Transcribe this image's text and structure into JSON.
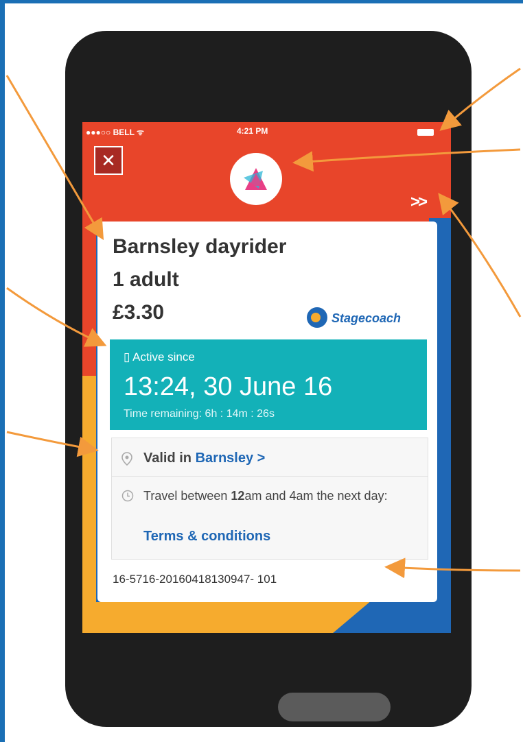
{
  "status_bar": {
    "carrier": "●●●○○ BELL ᯤ",
    "time": "4:21 PM"
  },
  "header": {
    "close_label": "✕",
    "next_label": ">>"
  },
  "ticket": {
    "name": "Barnsley dayrider",
    "quantity": "1 adult",
    "price": "£3.30",
    "operator": "Stagecoach"
  },
  "activation": {
    "label": "▯ Active since",
    "datetime": "13:24, 30 June 16",
    "remaining": "Time remaining: 6h : 14m : 26s"
  },
  "validity": {
    "prefix": "Valid in",
    "zone_link": "Barnsley >"
  },
  "travel": {
    "part1": "Travel between",
    "start_hour": "12",
    "part2": "am and 4am the next day:",
    "terms_link": "Terms & conditions"
  },
  "reference": "16-5716-20160418130947- 101",
  "colors": {
    "header_red": "#e8452a",
    "teal": "#13b1b8",
    "link_blue": "#1f67b5",
    "yellow": "#f6ab2e",
    "annotation_orange": "#f39a3c"
  }
}
